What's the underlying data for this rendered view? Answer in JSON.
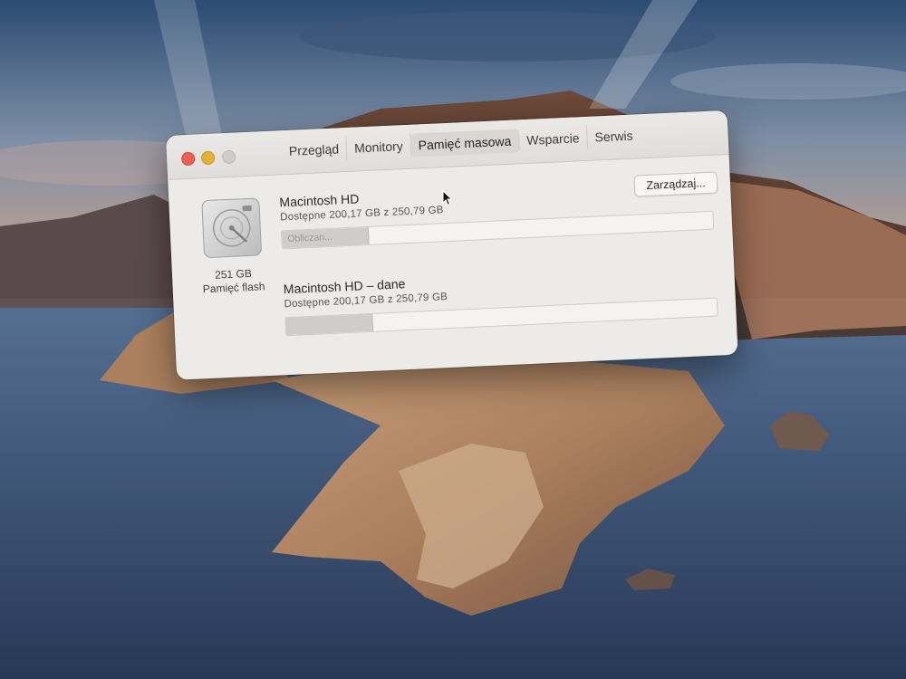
{
  "window": {
    "tabs": [
      {
        "label": "Przegląd"
      },
      {
        "label": "Monitory"
      },
      {
        "label": "Pamięć masowa"
      },
      {
        "label": "Wsparcie"
      },
      {
        "label": "Serwis"
      }
    ],
    "active_tab": "Pamięć masowa"
  },
  "disk": {
    "icon": "hard-drive-icon",
    "size": "251 GB",
    "kind": "Pamięć flash"
  },
  "volumes": [
    {
      "name": "Macintosh HD",
      "available": "Dostępne 200,17 GB z 250,79 GB",
      "used_fraction": 0.2,
      "bar_label": "Obliczan..."
    },
    {
      "name": "Macintosh HD – dane",
      "available": "Dostępne 200,17 GB z 250,79 GB",
      "used_fraction": 0.2,
      "bar_label": ""
    }
  ],
  "manage_button": "Zarządzaj...",
  "colors": {
    "close": "#ec5f55",
    "minimize": "#e3b138",
    "zoom_disabled": "#cfcdca",
    "window_bg": "#ecebe8"
  }
}
